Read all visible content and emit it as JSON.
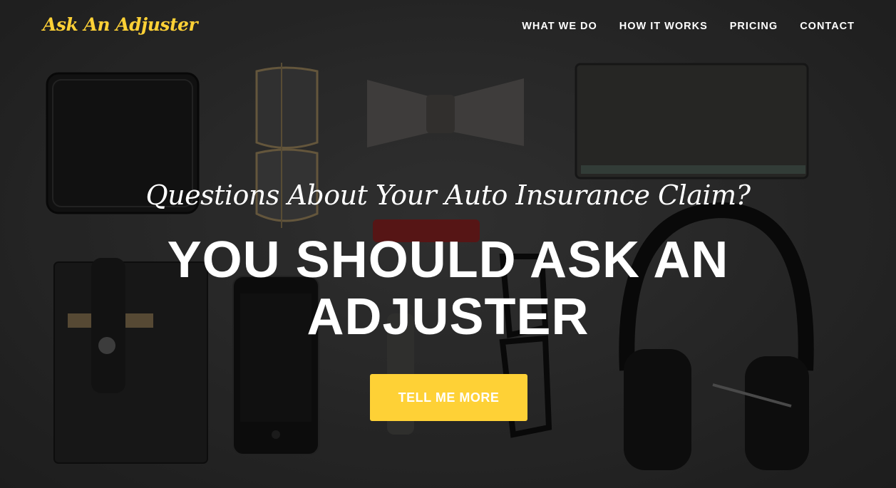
{
  "brand": {
    "name": "Ask An Adjuster",
    "color": "#fed136"
  },
  "nav": {
    "items": [
      {
        "label": "WHAT WE DO"
      },
      {
        "label": "HOW IT WORKS"
      },
      {
        "label": "PRICING"
      },
      {
        "label": "CONTACT"
      }
    ]
  },
  "hero": {
    "lead": "Questions About Your Auto Insurance Claim?",
    "heading_line1": "YOU SHOULD ASK AN",
    "heading_line2": "ADJUSTER",
    "cta_label": "TELL ME MORE",
    "background_items": [
      "wallet",
      "aviator-sunglasses",
      "bow-tie",
      "notebook",
      "pocketknife",
      "card-sleeve",
      "smartphone",
      "wristwatch",
      "eyeglasses",
      "headphones"
    ]
  },
  "colors": {
    "accent": "#fed136",
    "text": "#ffffff",
    "background": "#2b2b2b"
  }
}
